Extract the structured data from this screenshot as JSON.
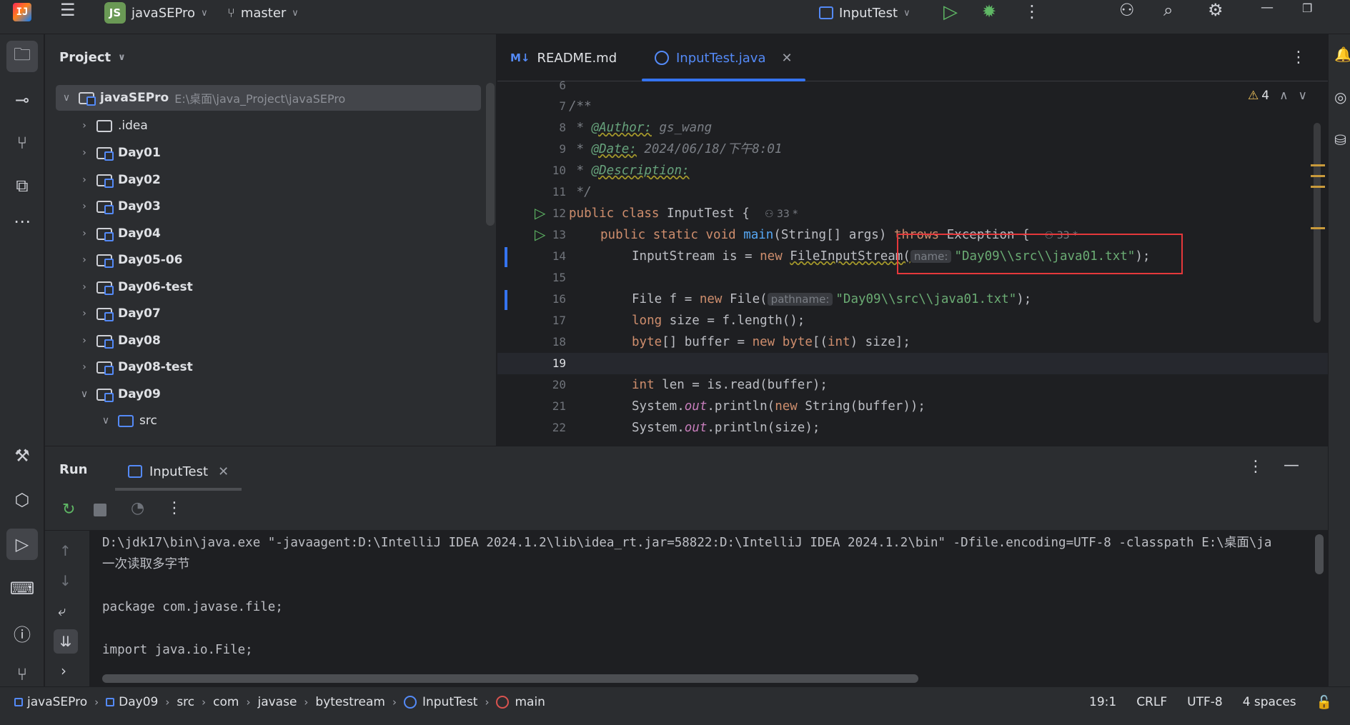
{
  "titlebar": {
    "logo": "IJ",
    "project_badge": "JS",
    "project_name": "javaSEPro",
    "branch": "master",
    "run_config": "InputTest",
    "icons": [
      "menu-icon",
      "branch-icon",
      "run-config-icon",
      "run-icon",
      "debug-icon",
      "more-icon",
      "add-user-icon",
      "search-icon",
      "settings-icon",
      "minimize-icon",
      "restore-icon"
    ]
  },
  "project": {
    "title": "Project",
    "tree": [
      {
        "label": "javaSEPro",
        "path": "E:\\桌面\\java_Project\\javaSEPro",
        "expanded": true
      },
      {
        "label": ".idea"
      },
      {
        "label": "Day01"
      },
      {
        "label": "Day02"
      },
      {
        "label": "Day03"
      },
      {
        "label": "Day04"
      },
      {
        "label": "Day05-06"
      },
      {
        "label": "Day06-test"
      },
      {
        "label": "Day07"
      },
      {
        "label": "Day08"
      },
      {
        "label": "Day08-test"
      },
      {
        "label": "Day09",
        "expanded": true
      },
      {
        "label": "src",
        "expanded": true
      }
    ]
  },
  "tabs": [
    {
      "label": "README.md",
      "icon": "M↓"
    },
    {
      "label": "InputTest.java",
      "active": true
    }
  ],
  "editor": {
    "warnings": "4",
    "line_numbers": [
      "6",
      "7",
      "8",
      "9",
      "10",
      "11",
      "12",
      "13",
      "14",
      "15",
      "16",
      "17",
      "18",
      "19",
      "20",
      "21",
      "22"
    ],
    "author_count": "33 *",
    "lines": {
      "l7": "/**",
      "l8_prefix": " * ",
      "l8_tag": "@Author:",
      "l8_val": " gs_wang",
      "l9_tag": "@Date:",
      "l9_val": " 2024/06/18/下午8:01",
      "l10_tag": "@Description:",
      "l11": " */",
      "l12_a": "public class ",
      "l12_b": "InputTest {",
      "l13_a": "public static void ",
      "l13_fn": "main",
      "l13_b": "(String[] args) ",
      "l13_c": "throws ",
      "l13_d": "Exception {",
      "l14_a": "InputStream is = ",
      "l14_new": "new ",
      "l14_b": "FileInputStream(",
      "l14_hint": "name:",
      "l14_str": "\"Day09\\\\src\\\\java01.txt\"",
      "l14_end": ");",
      "l16_a": "File f = ",
      "l16_new": "new ",
      "l16_b": "File(",
      "l16_hint": "pathname:",
      "l16_str": "\"Day09\\\\src\\\\java01.txt\"",
      "l16_end": ");",
      "l17_kw": "long ",
      "l17_b": "size = f.length();",
      "l18_kw": "byte",
      "l18_b": "[] buffer = ",
      "l18_new": "new ",
      "l18_kw2": "byte",
      "l18_c": "[(",
      "l18_kw3": "int",
      "l18_d": ") size];",
      "l20_kw": "int ",
      "l20_b": "len = is.read(buffer);",
      "l21_a": "System.",
      "l21_field": "out",
      "l21_b": ".println(",
      "l21_new": "new ",
      "l21_c": "String(buffer));",
      "l22_a": "System.",
      "l22_field": "out",
      "l22_b": ".println(size);"
    }
  },
  "run": {
    "title": "Run",
    "tab": "InputTest",
    "output": [
      "D:\\jdk17\\bin\\java.exe \"-javaagent:D:\\IntelliJ IDEA 2024.1.2\\lib\\idea_rt.jar=58822:D:\\IntelliJ IDEA 2024.1.2\\bin\" -Dfile.encoding=UTF-8 -classpath E:\\桌面\\ja",
      "一次读取多字节",
      "",
      "package com.javase.file;",
      "",
      "import java.io.File;"
    ]
  },
  "statusbar": {
    "breadcrumbs": [
      "javaSEPro",
      "Day09",
      "src",
      "com",
      "javase",
      "bytestream",
      "InputTest",
      "main"
    ],
    "position": "19:1",
    "line_ending": "CRLF",
    "encoding": "UTF-8",
    "indent": "4 spaces"
  },
  "colors": {
    "background": "#1e1f22",
    "panel": "#2b2d30",
    "accent": "#3574f0",
    "keyword": "#cf8e6d",
    "string": "#6aab73",
    "run_green": "#5fb865",
    "highlight_box": "#e5383b"
  }
}
